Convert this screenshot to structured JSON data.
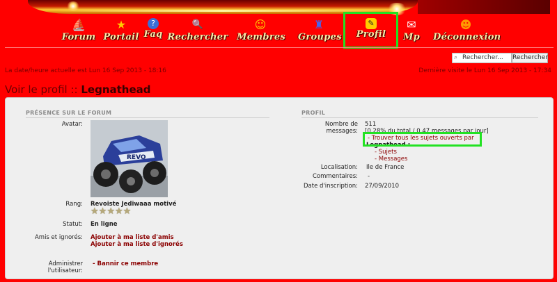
{
  "nav": {
    "items": [
      {
        "label": "Forum",
        "icon": "forum-icon",
        "glyph": "⛵"
      },
      {
        "label": "Portail",
        "icon": "star-icon",
        "glyph": "★"
      },
      {
        "label": "Faq",
        "icon": "faq-icon",
        "glyph": "?"
      },
      {
        "label": "Rechercher",
        "icon": "search-icon",
        "glyph": "🔍"
      },
      {
        "label": "Membres",
        "icon": "members-icon",
        "glyph": "☺"
      },
      {
        "label": "Groupes",
        "icon": "groups-icon",
        "glyph": "♜"
      },
      {
        "label": "Profil",
        "icon": "profile-icon",
        "glyph": "✎"
      },
      {
        "label": "Mp",
        "icon": "mail-icon",
        "glyph": "✉"
      },
      {
        "label": "Déconnexion",
        "icon": "logout-icon",
        "glyph": "☻"
      }
    ]
  },
  "search": {
    "placeholder": "Rechercher...",
    "button": "Rechercher"
  },
  "info": {
    "current_date": "La date/heure actuelle est Lun 16 Sep 2013 - 18:16",
    "last_visit": "Dernière visite le Lun 16 Sep 2013 - 17:34"
  },
  "title": {
    "prefix": "Voir le profil :: ",
    "username": "Legnathead"
  },
  "left": {
    "heading": "PRÉSENCE SUR LE FORUM",
    "avatar_label": "Avatar:",
    "rank_label": "Rang:",
    "rank_value": "Revoiste Jediwaaa motivé",
    "status_label": "Statut:",
    "status_value": "En ligne",
    "friends_label": "Amis et ignorés:",
    "add_friend": "Ajouter à ma liste d'amis",
    "add_ignore": "Ajouter à ma liste d'ignorés",
    "admin_label_1": "Administrer",
    "admin_label_2": "l'utilisateur:",
    "ban": "- Bannir ce membre"
  },
  "right": {
    "heading": "PROFIL",
    "messages_label_1": "Nombre de",
    "messages_label_2": "messages:",
    "messages_count": "511",
    "messages_stats": "[0.28% du total / 0.47 messages par jour]",
    "find_topics": "- Trouver tous les sujets ouverts par",
    "find_user": "Legnathead :",
    "sujets": "- Sujets",
    "messages": "- Messages",
    "location_label": "Localisation:",
    "location_value": "Ile de France",
    "comments_label": "Commentaires:",
    "comments_value": "-",
    "signup_label": "Date d'inscription:",
    "signup_value": "27/09/2010"
  },
  "colors": {
    "background": "#ff0000",
    "panel": "#efefef",
    "highlight": "#22e222",
    "link": "#8b0000"
  }
}
